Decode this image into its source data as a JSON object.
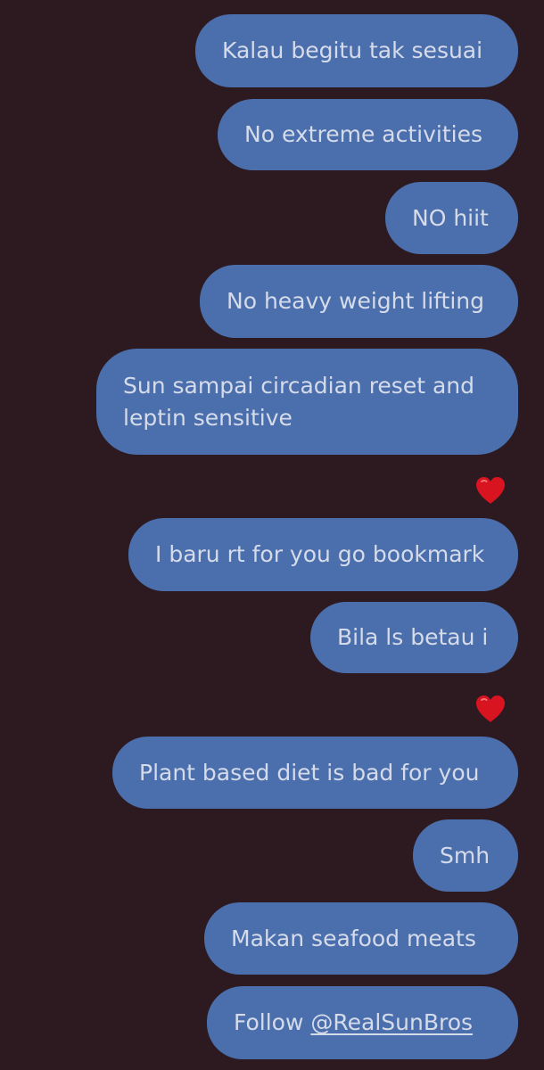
{
  "thread": {
    "messages": [
      {
        "text": "Kalau begitu tak sesuai"
      },
      {
        "text": "No extreme activities"
      },
      {
        "text": "NO hiit"
      },
      {
        "text": "No heavy weight lifting"
      },
      {
        "text": "Sun sampai circadian reset and leptin sensitive",
        "reaction": "heart"
      },
      {
        "text": "I baru rt for you go bookmark"
      },
      {
        "text": "Bila ls betau i",
        "reaction": "heart"
      },
      {
        "text": "Plant based diet is bad for you"
      },
      {
        "text": "Smh"
      },
      {
        "text": "Makan seafood meats"
      },
      {
        "text_prefix": "Follow ",
        "mention": "@RealSunBros"
      }
    ]
  },
  "colors": {
    "background": "#2d1a21",
    "bubble": "#4a6fac",
    "bubble_text": "#d6dbea",
    "heart": "#d7141f"
  },
  "icons": {
    "reaction": "red-heart-icon"
  }
}
